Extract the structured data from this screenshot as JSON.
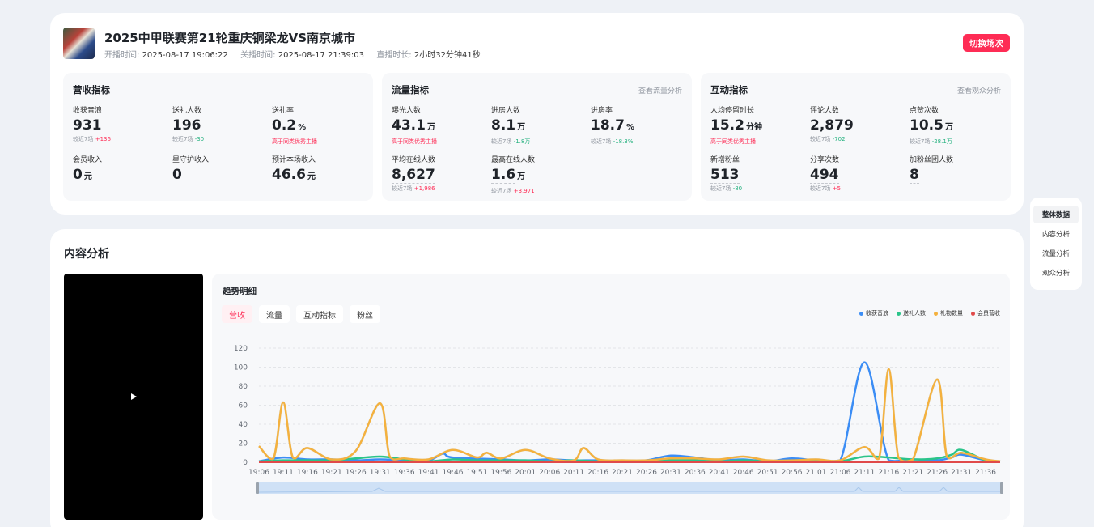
{
  "header": {
    "title": "2025中甲联赛第21轮重庆铜梁龙VS南京城市",
    "start_label": "开播时间:",
    "start_time": "2025-08-17 19:06:22",
    "end_label": "关播时间:",
    "end_time": "2025-08-17 21:39:03",
    "duration_label": "直播时长:",
    "duration": "2小时32分钟41秒",
    "switch_button": "切换场次"
  },
  "revenue": {
    "title": "营收指标",
    "metrics": [
      {
        "label": "收获音浪",
        "value": "931",
        "unit": "",
        "cmp": "较近7场",
        "delta": "+136",
        "dir": "up"
      },
      {
        "label": "送礼人数",
        "value": "196",
        "unit": "",
        "cmp": "较近7场",
        "delta": "-30",
        "dir": "down"
      },
      {
        "label": "送礼率",
        "value": "0.2",
        "unit": "%",
        "cmp": "",
        "delta": "",
        "note": "高于同类优秀主播"
      },
      {
        "label": "会员收入",
        "value": "0",
        "unit": "元"
      },
      {
        "label": "星守护收入",
        "value": "0",
        "unit": ""
      },
      {
        "label": "预计本场收入",
        "value": "46.6",
        "unit": "元"
      }
    ]
  },
  "traffic": {
    "title": "流量指标",
    "link": "查看流量分析",
    "metrics": [
      {
        "label": "曝光人数",
        "value": "43.1",
        "unit": "万",
        "note": "高于同类优秀主播"
      },
      {
        "label": "进房人数",
        "value": "8.1",
        "unit": "万",
        "cmp": "较近7场",
        "delta": "-1.8万",
        "dir": "down"
      },
      {
        "label": "进房率",
        "value": "18.7",
        "unit": "%",
        "cmp": "较近7场",
        "delta": "-18.3%",
        "dir": "down"
      },
      {
        "label": "平均在线人数",
        "value": "8,627",
        "unit": "",
        "cmp": "较近7场",
        "delta": "+1,986",
        "dir": "up"
      },
      {
        "label": "最高在线人数",
        "value": "1.6",
        "unit": "万",
        "cmp": "较近7场",
        "delta": "+3,971",
        "dir": "up"
      }
    ]
  },
  "interaction": {
    "title": "互动指标",
    "link": "查看观众分析",
    "metrics": [
      {
        "label": "人均停留时长",
        "value": "15.2",
        "unit": "分钟",
        "note": "高于同类优秀主播"
      },
      {
        "label": "评论人数",
        "value": "2,879",
        "unit": "",
        "cmp": "较近7场",
        "delta": "-702",
        "dir": "down"
      },
      {
        "label": "点赞次数",
        "value": "10.5",
        "unit": "万",
        "cmp": "较近7场",
        "delta": "-28.1万",
        "dir": "down"
      },
      {
        "label": "新增粉丝",
        "value": "513",
        "unit": "",
        "cmp": "较近7场",
        "delta": "-80",
        "dir": "down"
      },
      {
        "label": "分享次数",
        "value": "494",
        "unit": "",
        "cmp": "较近7场",
        "delta": "+5",
        "dir": "up"
      },
      {
        "label": "加粉丝团人数",
        "value": "8",
        "unit": ""
      }
    ]
  },
  "content": {
    "title": "内容分析",
    "trend_title": "趋势明细",
    "tabs": [
      "营收",
      "流量",
      "互动指标",
      "粉丝"
    ]
  },
  "sidenav": [
    "整体数据",
    "内容分析",
    "流量分析",
    "观众分析"
  ],
  "colors": {
    "accent": "#fe2c55",
    "up": "#fe2c55",
    "down": "#22b07d"
  },
  "chart_data": {
    "type": "line",
    "title": "",
    "xlabel": "",
    "ylabel": "",
    "ylim": [
      0,
      120
    ],
    "yticks": [
      0,
      20,
      40,
      60,
      80,
      100,
      120
    ],
    "x_tick_labels": [
      "19:06",
      "19:11",
      "19:16",
      "19:21",
      "19:26",
      "19:31",
      "19:36",
      "19:41",
      "19:46",
      "19:51",
      "19:56",
      "20:01",
      "20:06",
      "20:11",
      "20:16",
      "20:21",
      "20:26",
      "20:31",
      "20:36",
      "20:41",
      "20:46",
      "20:51",
      "20:56",
      "21:01",
      "21:06",
      "21:11",
      "21:16",
      "21:21",
      "21:26",
      "21:31",
      "21:36"
    ],
    "legend_position": "top-right",
    "grid": true,
    "series": [
      {
        "name": "收获音浪",
        "color": "#3b8df5",
        "points": [
          [
            19.06,
            1
          ],
          [
            19.11,
            5
          ],
          [
            19.16,
            3
          ],
          [
            19.21,
            3
          ],
          [
            19.26,
            2
          ],
          [
            19.31,
            3
          ],
          [
            19.36,
            2
          ],
          [
            19.41,
            2
          ],
          [
            19.44,
            9
          ],
          [
            19.46,
            5
          ],
          [
            19.56,
            3
          ],
          [
            20.01,
            2
          ],
          [
            20.06,
            3
          ],
          [
            20.11,
            2
          ],
          [
            20.16,
            2
          ],
          [
            20.21,
            1
          ],
          [
            20.26,
            2
          ],
          [
            20.31,
            7
          ],
          [
            20.36,
            5
          ],
          [
            20.41,
            2
          ],
          [
            20.46,
            3
          ],
          [
            20.51,
            1
          ],
          [
            20.56,
            4
          ],
          [
            21.01,
            2
          ],
          [
            21.06,
            2
          ],
          [
            21.11,
            105
          ],
          [
            21.16,
            2
          ],
          [
            21.21,
            3
          ],
          [
            21.26,
            2
          ],
          [
            21.29,
            5
          ],
          [
            21.31,
            8
          ],
          [
            21.36,
            2
          ],
          [
            21.39,
            1
          ]
        ]
      },
      {
        "name": "送礼人数",
        "color": "#2bc48a",
        "points": [
          [
            19.06,
            1
          ],
          [
            19.11,
            2
          ],
          [
            19.16,
            2
          ],
          [
            19.21,
            2
          ],
          [
            19.26,
            4
          ],
          [
            19.31,
            6
          ],
          [
            19.36,
            3
          ],
          [
            19.41,
            1
          ],
          [
            19.46,
            3
          ],
          [
            19.51,
            2
          ],
          [
            19.56,
            2
          ],
          [
            20.01,
            2
          ],
          [
            20.06,
            1
          ],
          [
            20.11,
            2
          ],
          [
            20.16,
            1
          ],
          [
            20.21,
            1
          ],
          [
            20.26,
            1
          ],
          [
            20.31,
            2
          ],
          [
            20.36,
            2
          ],
          [
            20.41,
            1
          ],
          [
            20.46,
            2
          ],
          [
            20.51,
            1
          ],
          [
            20.56,
            1
          ],
          [
            21.01,
            2
          ],
          [
            21.06,
            1
          ],
          [
            21.11,
            6
          ],
          [
            21.16,
            5
          ],
          [
            21.21,
            3
          ],
          [
            21.26,
            4
          ],
          [
            21.29,
            8
          ],
          [
            21.31,
            13
          ],
          [
            21.36,
            2
          ],
          [
            21.39,
            1
          ]
        ]
      },
      {
        "name": "礼物数量",
        "color": "#f4b13e",
        "points": [
          [
            19.06,
            17
          ],
          [
            19.09,
            4
          ],
          [
            19.11,
            63
          ],
          [
            19.13,
            5
          ],
          [
            19.16,
            15
          ],
          [
            19.21,
            3
          ],
          [
            19.26,
            12
          ],
          [
            19.31,
            62
          ],
          [
            19.33,
            6
          ],
          [
            19.36,
            4
          ],
          [
            19.41,
            3
          ],
          [
            19.46,
            13
          ],
          [
            19.51,
            5
          ],
          [
            19.53,
            10
          ],
          [
            19.56,
            4
          ],
          [
            20.01,
            13
          ],
          [
            20.06,
            4
          ],
          [
            20.11,
            2
          ],
          [
            20.13,
            15
          ],
          [
            20.16,
            3
          ],
          [
            20.21,
            2
          ],
          [
            20.26,
            2
          ],
          [
            20.31,
            4
          ],
          [
            20.36,
            4
          ],
          [
            20.41,
            3
          ],
          [
            20.46,
            6
          ],
          [
            20.51,
            2
          ],
          [
            20.56,
            2
          ],
          [
            21.01,
            3
          ],
          [
            21.06,
            2
          ],
          [
            21.11,
            16
          ],
          [
            21.14,
            4
          ],
          [
            21.16,
            98
          ],
          [
            21.18,
            5
          ],
          [
            21.21,
            3
          ],
          [
            21.26,
            87
          ],
          [
            21.28,
            6
          ],
          [
            21.31,
            10
          ],
          [
            21.36,
            3
          ],
          [
            21.39,
            1
          ]
        ]
      },
      {
        "name": "会员营收",
        "color": "#e04a4a",
        "points": [
          [
            19.06,
            0
          ],
          [
            21.39,
            0
          ]
        ]
      }
    ]
  }
}
